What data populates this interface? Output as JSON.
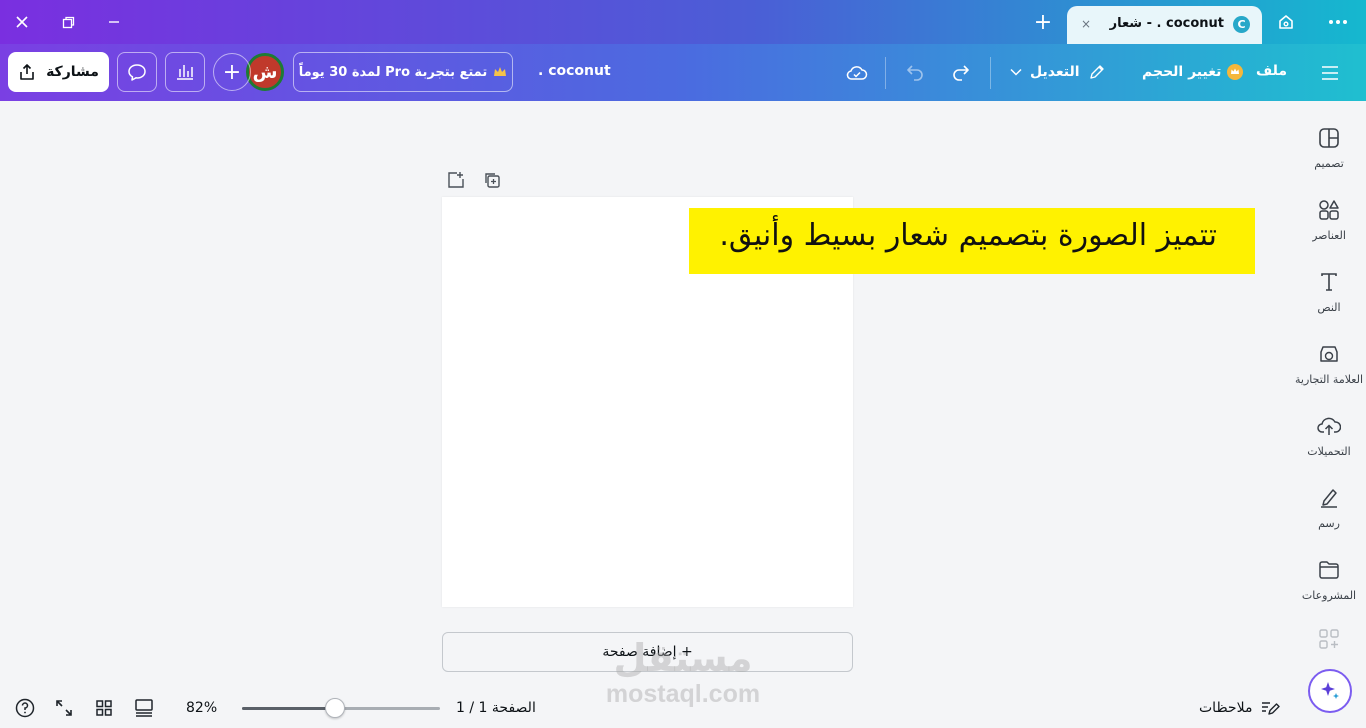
{
  "titlebar": {
    "tab_title": "coconut . - شعار",
    "tab_favicon": "C",
    "tab_close": "×",
    "new_tab": "+",
    "icons": [
      "close-icon",
      "restore-icon",
      "minimize-icon",
      "home-icon",
      "more-icon"
    ]
  },
  "toolbar": {
    "menu_label": "ملف",
    "resize_label": "تغيير الحجم",
    "edit_label": "التعديل",
    "doc_title": "coconut .",
    "pro_label": "تمتع بتجربة Pro لمدة 30 يوماً",
    "avatar_initial": "ش",
    "add_label": "+",
    "share_label": "مشاركة"
  },
  "sidepanel": {
    "items": [
      {
        "label": "تصميم",
        "icon": "design-icon"
      },
      {
        "label": "العناصر",
        "icon": "elements-icon"
      },
      {
        "label": "النص",
        "icon": "text-icon"
      },
      {
        "label": "العلامة التجارية",
        "icon": "brand-icon"
      },
      {
        "label": "التحميلات",
        "icon": "upload-icon"
      },
      {
        "label": "رسم",
        "icon": "draw-icon"
      },
      {
        "label": "المشروعات",
        "icon": "folder-icon"
      }
    ]
  },
  "canvas": {
    "text": "تتميز الصورة بتصميم شعار بسيط وأنيق.",
    "text_bg": "#fff200",
    "add_page_label": "+ إضافة صفحة"
  },
  "watermark": {
    "ar": "مستقل",
    "en": "mostaql.com"
  },
  "footer": {
    "notes_label": "ملاحظات",
    "page_label": "الصفحة 1 / 1",
    "zoom_label": "82%",
    "zoom_fraction": 0.47
  }
}
